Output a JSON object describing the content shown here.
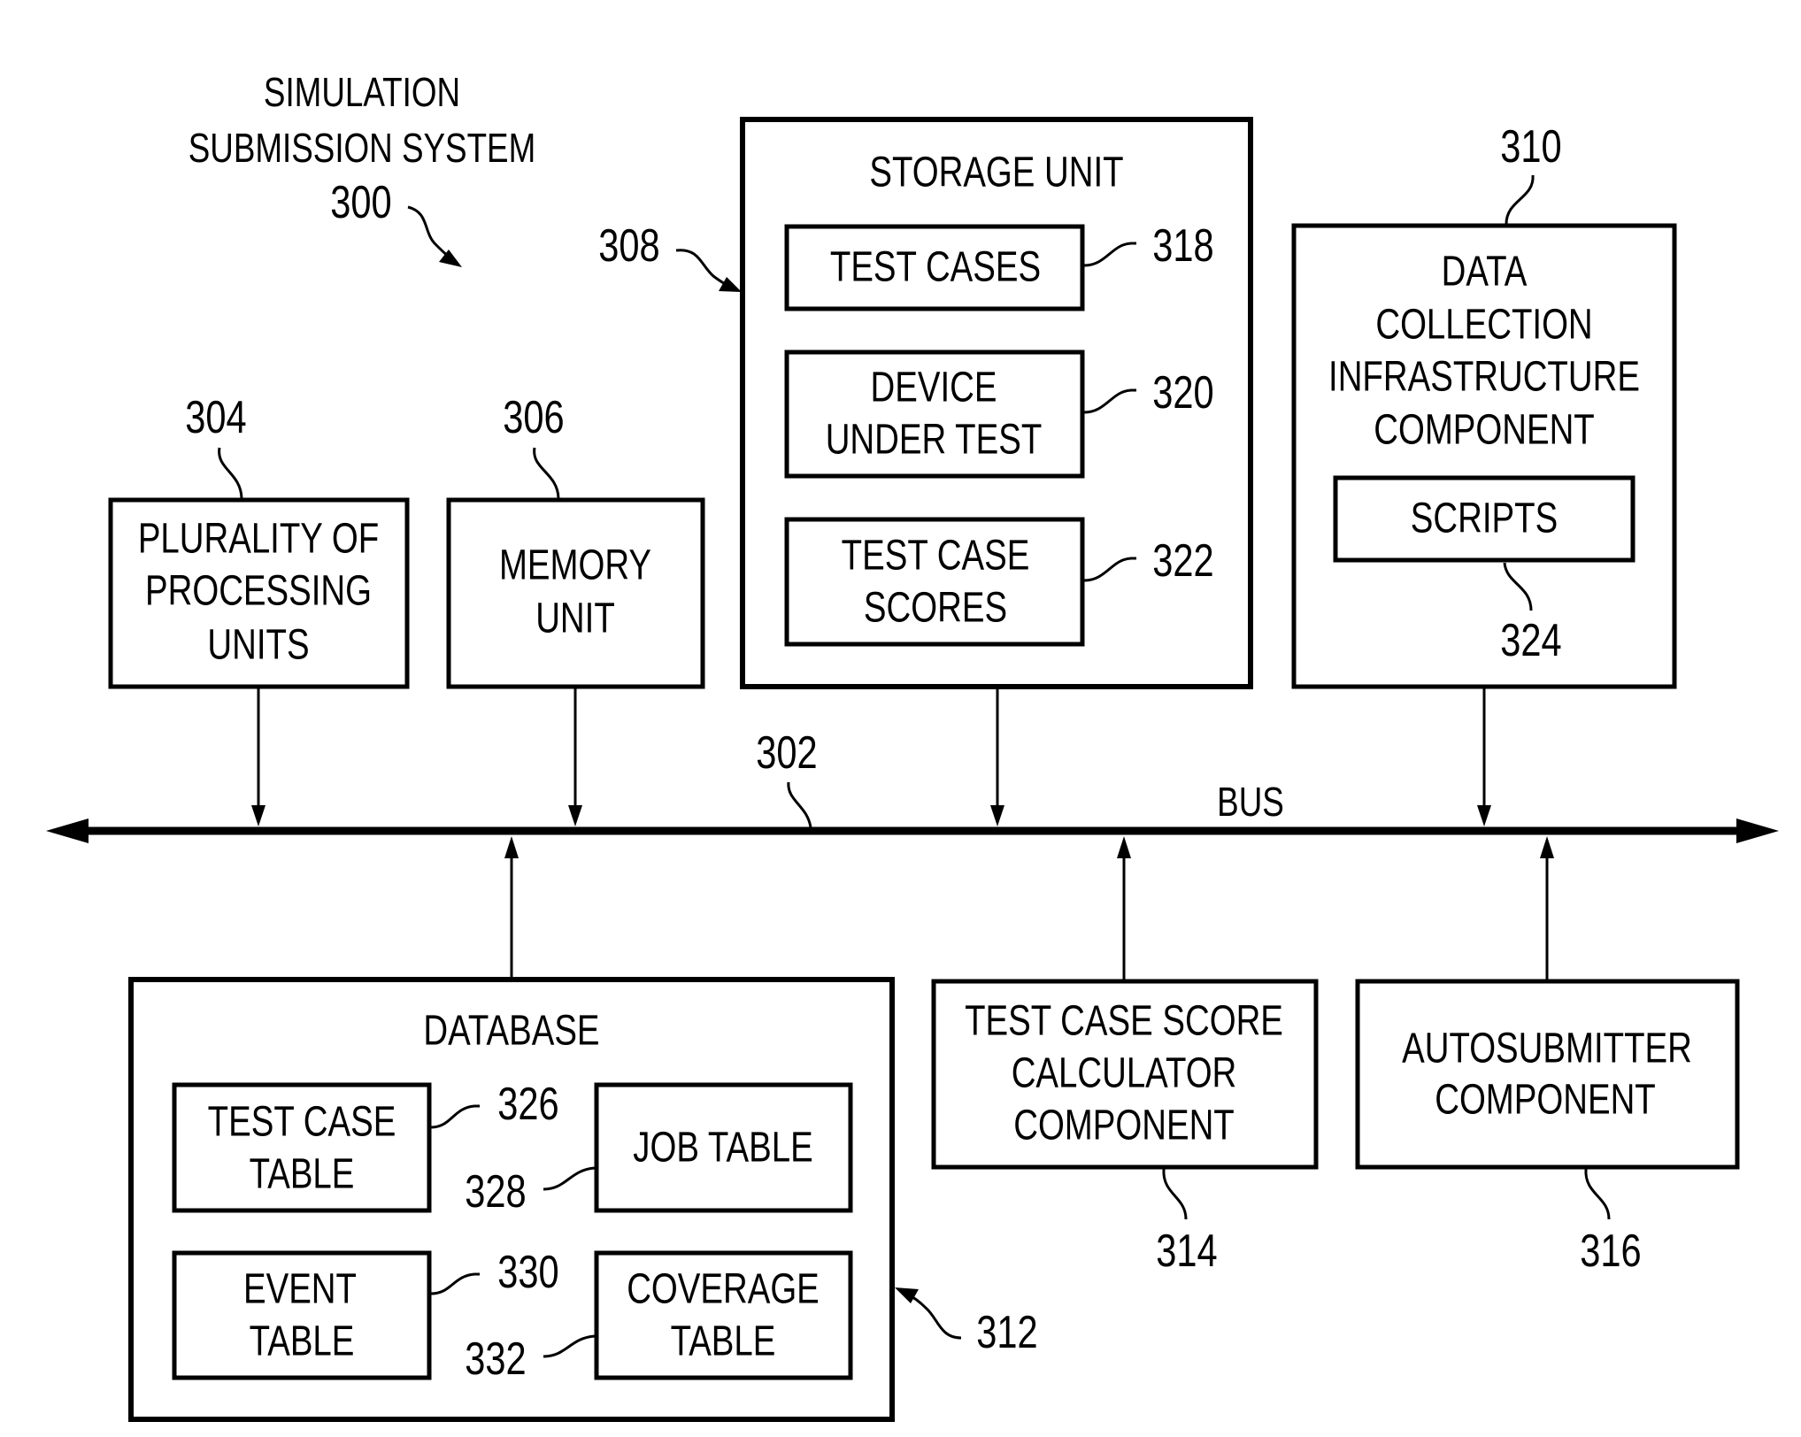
{
  "diagram": {
    "title_lines": [
      "SIMULATION",
      "SUBMISSION SYSTEM"
    ],
    "system_ref": "300",
    "bus": {
      "label": "BUS",
      "ref": "302"
    },
    "components": {
      "processing_units": {
        "lines": [
          "PLURALITY OF",
          "PROCESSING",
          "UNITS"
        ],
        "ref": "304"
      },
      "memory_unit": {
        "lines": [
          "MEMORY",
          "UNIT"
        ],
        "ref": "306"
      },
      "storage_unit": {
        "title": "STORAGE UNIT",
        "ref": "308",
        "children": [
          {
            "lines": [
              "TEST CASES"
            ],
            "ref": "318"
          },
          {
            "lines": [
              "DEVICE",
              "UNDER TEST"
            ],
            "ref": "320"
          },
          {
            "lines": [
              "TEST CASE",
              "SCORES"
            ],
            "ref": "322"
          }
        ]
      },
      "data_collection": {
        "lines": [
          "DATA",
          "COLLECTION",
          "INFRASTRUCTURE",
          "COMPONENT"
        ],
        "ref": "310",
        "child": {
          "lines": [
            "SCRIPTS"
          ],
          "ref": "324"
        }
      },
      "database": {
        "title": "DATABASE",
        "ref": "312",
        "children": [
          {
            "lines": [
              "TEST CASE",
              "TABLE"
            ],
            "ref": "326"
          },
          {
            "lines": [
              "JOB TABLE"
            ],
            "ref": "328"
          },
          {
            "lines": [
              "EVENT",
              "TABLE"
            ],
            "ref": "330"
          },
          {
            "lines": [
              "COVERAGE",
              "TABLE"
            ],
            "ref": "332"
          }
        ]
      },
      "score_calculator": {
        "lines": [
          "TEST CASE SCORE",
          "CALCULATOR",
          "COMPONENT"
        ],
        "ref": "314"
      },
      "autosubmitter": {
        "lines": [
          "AUTOSUBMITTER",
          "COMPONENT"
        ],
        "ref": "316"
      }
    }
  }
}
